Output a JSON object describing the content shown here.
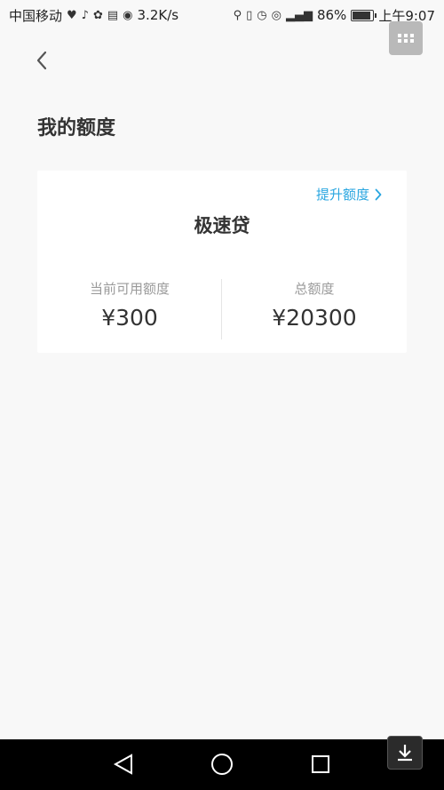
{
  "status_bar": {
    "carrier": "中国移动",
    "net_speed": "3.2K/s",
    "battery": "86%",
    "time": "上午9:07",
    "icons": [
      "heart-icon",
      "tiktok-icon",
      "baidu-icon",
      "news-icon",
      "app-icon",
      "location-icon",
      "vibrate-icon",
      "alarm-icon",
      "eye-icon",
      "signal-icon",
      "battery-icon"
    ]
  },
  "header": {
    "back_icon": "chevron-left-icon"
  },
  "page": {
    "title": "我的额度"
  },
  "card": {
    "raise_link": "提升额度",
    "product": "极速贷",
    "available_label": "当前可用额度",
    "available_value": "¥300",
    "total_label": "总额度",
    "total_value": "¥20300"
  },
  "colors": {
    "accent": "#29a6e0",
    "background": "#f8f8f8",
    "card": "#ffffff"
  }
}
